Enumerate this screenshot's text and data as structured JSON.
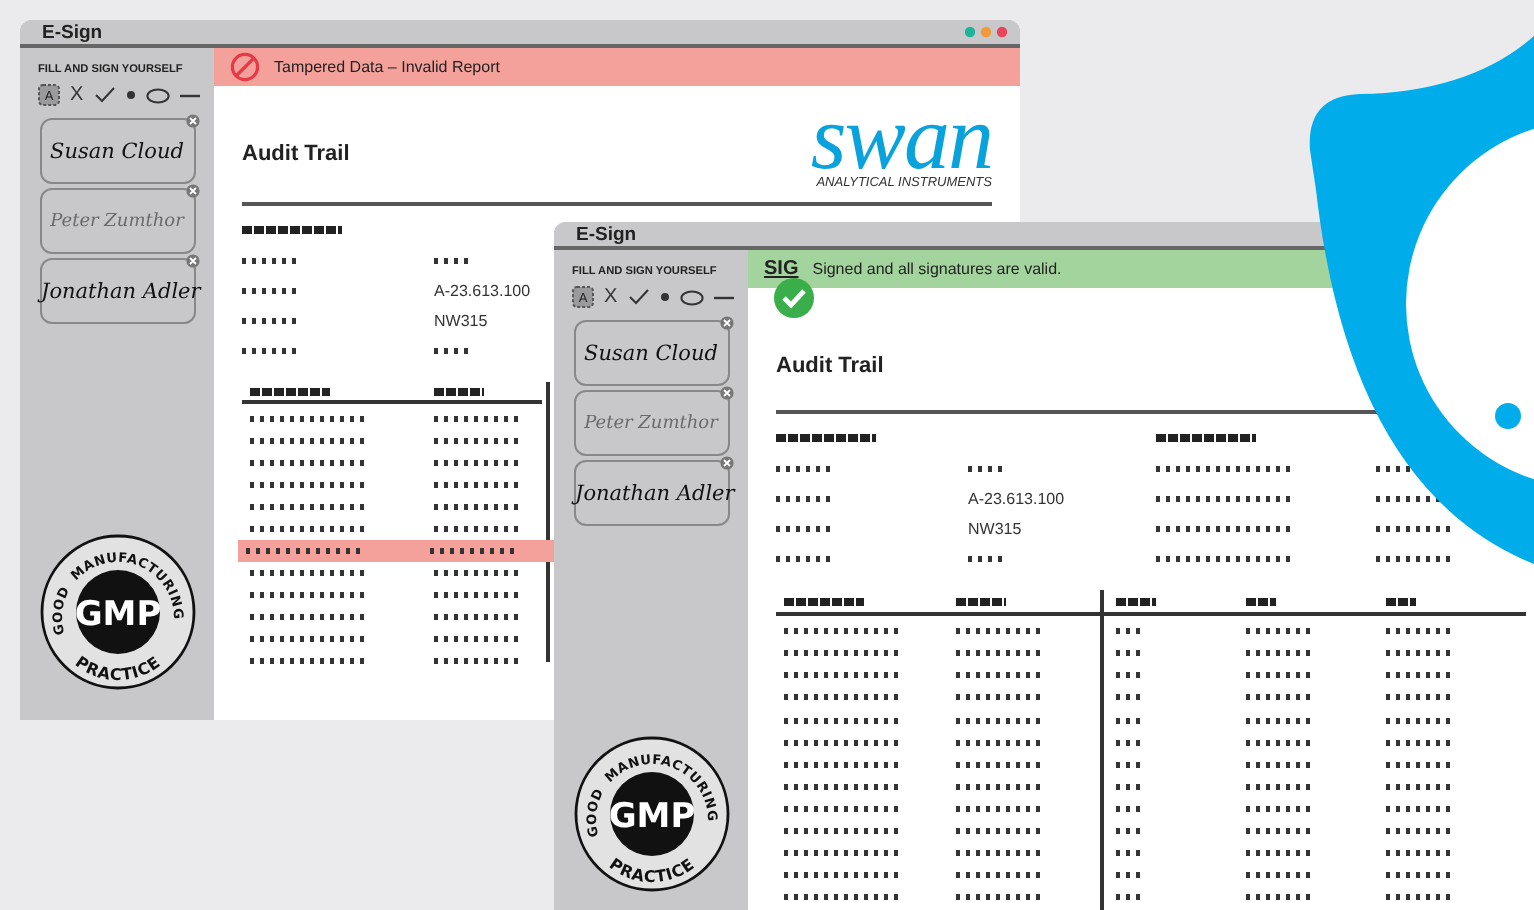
{
  "windows": [
    {
      "title": "E-Sign",
      "window_controls": true,
      "status": {
        "kind": "invalid",
        "message": "Tampered Data – Invalid Report"
      },
      "sidebar": {
        "heading": "FILL AND SIGN YOURSELF",
        "tools": [
          {
            "kind": "text-box",
            "label": "A"
          },
          {
            "kind": "char",
            "label": "X"
          },
          {
            "kind": "check"
          },
          {
            "kind": "dot"
          },
          {
            "kind": "ellipse"
          },
          {
            "kind": "line"
          }
        ],
        "signatures": [
          {
            "name": "Susan Cloud",
            "faded": false
          },
          {
            "name": "Peter Zumthor",
            "faded": true
          },
          {
            "name": "Jonathan Adler",
            "faded": false
          }
        ],
        "seal": {
          "center": "GMP",
          "left": "GOOD",
          "top": "MANUFACTURING",
          "bottom": "PRACTICE"
        }
      },
      "logo": {
        "name": "swan",
        "tagline": "ANALYTICAL INSTRUMENTS"
      },
      "report": {
        "title": "Audit Trail",
        "columns": [
          {
            "kind": "marks"
          },
          {
            "kind": "marks"
          }
        ],
        "fields": [
          {
            "kind": "marks"
          },
          {
            "kind": "text",
            "value": "A-23.613.100"
          },
          {
            "kind": "text",
            "value": "NW315"
          },
          {
            "kind": "marks"
          }
        ],
        "rows": [
          {
            "flagged": false
          },
          {
            "flagged": false
          },
          {
            "flagged": false
          },
          {
            "flagged": false
          },
          {
            "flagged": false
          },
          {
            "flagged": false
          },
          {
            "flagged": true
          },
          {
            "flagged": false
          },
          {
            "flagged": false
          },
          {
            "flagged": false
          },
          {
            "flagged": false
          },
          {
            "flagged": false
          }
        ]
      }
    },
    {
      "title": "E-Sign",
      "window_controls": false,
      "status": {
        "kind": "valid",
        "badge": "SIG",
        "message": "Signed and all signatures are valid."
      },
      "sidebar": {
        "heading": "FILL AND SIGN YOURSELF",
        "tools": [
          {
            "kind": "text-box",
            "label": "A"
          },
          {
            "kind": "char",
            "label": "X"
          },
          {
            "kind": "check"
          },
          {
            "kind": "dot"
          },
          {
            "kind": "ellipse"
          },
          {
            "kind": "line"
          }
        ],
        "signatures": [
          {
            "name": "Susan Cloud",
            "faded": false
          },
          {
            "name": "Peter Zumthor",
            "faded": true
          },
          {
            "name": "Jonathan Adler",
            "faded": false
          }
        ],
        "seal": {
          "center": "GMP",
          "left": "GOOD",
          "top": "MANUFACTURING",
          "bottom": "PRACTICE"
        }
      },
      "report": {
        "title": "Audit Trail",
        "columns": [
          {
            "kind": "marks"
          },
          {
            "kind": "marks"
          },
          {
            "kind": "marks"
          },
          {
            "kind": "marks"
          },
          {
            "kind": "marks"
          }
        ],
        "fields": [
          {
            "kind": "marks"
          },
          {
            "kind": "text",
            "value": "A-23.613.100"
          },
          {
            "kind": "text",
            "value": "NW315"
          },
          {
            "kind": "marks"
          }
        ],
        "rows": [
          {
            "flagged": false
          },
          {
            "flagged": false
          },
          {
            "flagged": false
          },
          {
            "flagged": false
          },
          {
            "flagged": false
          },
          {
            "flagged": false
          },
          {
            "flagged": false
          },
          {
            "flagged": false
          },
          {
            "flagged": false
          },
          {
            "flagged": false
          },
          {
            "flagged": false
          },
          {
            "flagged": false
          },
          {
            "flagged": false
          }
        ]
      }
    }
  ]
}
